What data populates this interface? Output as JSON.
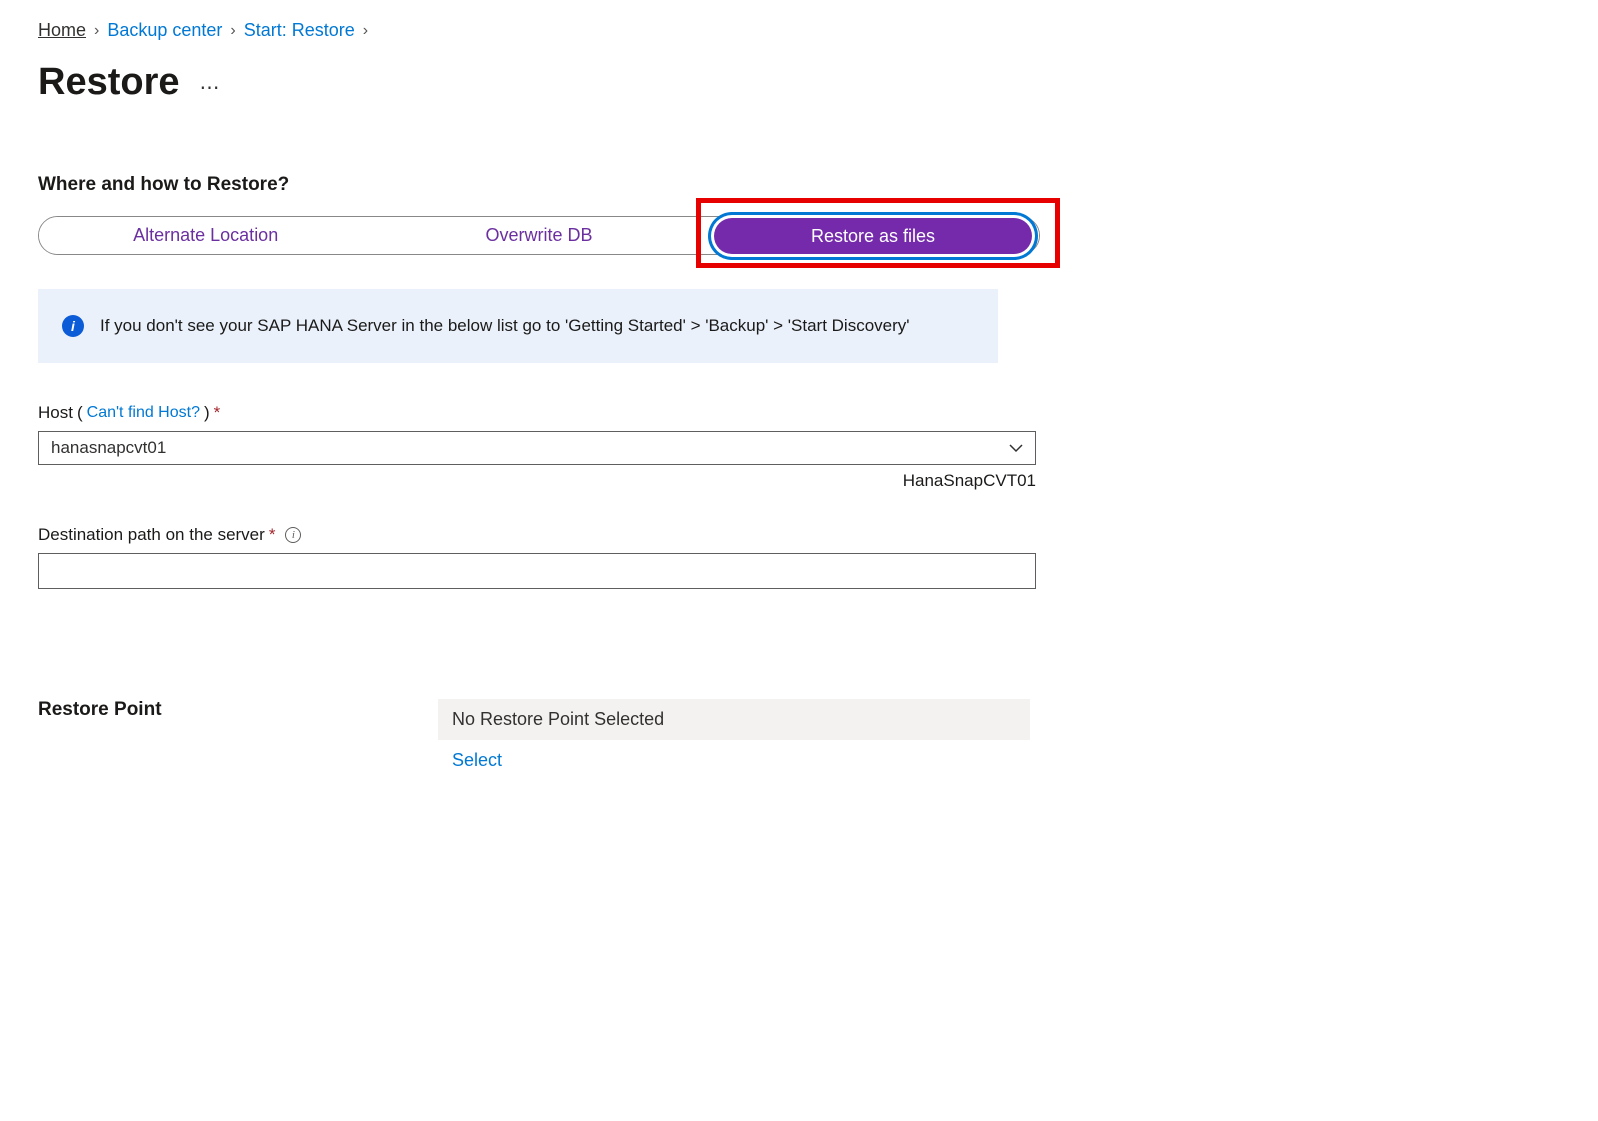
{
  "breadcrumb": {
    "home": "Home",
    "backup_center": "Backup center",
    "start_restore": "Start: Restore"
  },
  "page_title": "Restore",
  "section_heading": "Where and how to Restore?",
  "segments": {
    "alt_location": "Alternate Location",
    "overwrite_db": "Overwrite DB",
    "restore_files": "Restore as files"
  },
  "info_message": "If you don't see your SAP HANA Server in the below list go to 'Getting Started' > 'Backup' > 'Start Discovery'",
  "host": {
    "label": "Host",
    "link_text": "Can't find Host?",
    "value": "hanasnapcvt01",
    "helper": "HanaSnapCVT01"
  },
  "dest_path": {
    "label": "Destination path on the server",
    "value": ""
  },
  "restore_point": {
    "label": "Restore Point",
    "value": "No Restore Point Selected",
    "select_link": "Select"
  }
}
